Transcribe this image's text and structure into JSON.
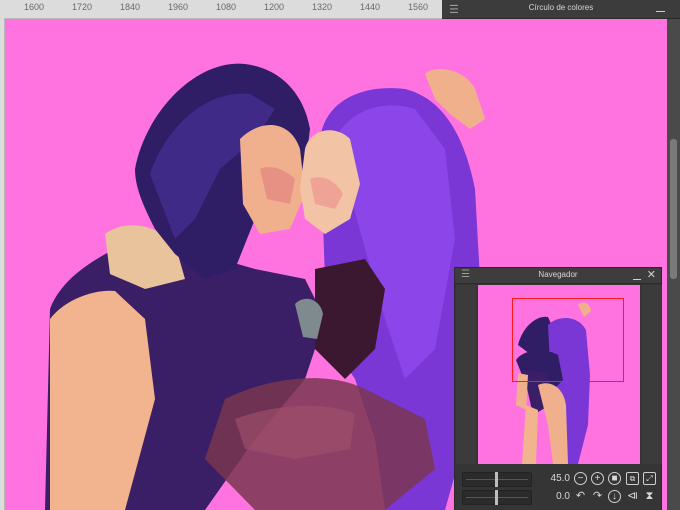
{
  "ruler": {
    "ticks": [
      "1600",
      "1720",
      "1840",
      "1960",
      "1080",
      "1200",
      "1320",
      "1440",
      "1560"
    ]
  },
  "color_panel": {
    "title": "Círculo de colores",
    "menu_icon": "hamburger-icon"
  },
  "navigator": {
    "title": "Navegador",
    "zoom_value": "45.0",
    "rotation_value": "0.0",
    "icons": {
      "zoom_out": "minus-circle-icon",
      "zoom_in": "plus-circle-icon",
      "actual_size": "stop-icon",
      "fit": "fit-window-icon",
      "fullscreen": "expand-icon",
      "rotate_left": "rotate-left-icon",
      "rotate_right": "rotate-right-icon",
      "reset_rotation": "reset-rotation-icon",
      "flip_horizontal": "flip-horizontal-icon",
      "flip_vertical": "flip-vertical-icon"
    }
  },
  "colors": {
    "canvas_bg": "#ff73e1",
    "panel_bg": "#353535",
    "nav_frame": "#ff1a1a"
  }
}
